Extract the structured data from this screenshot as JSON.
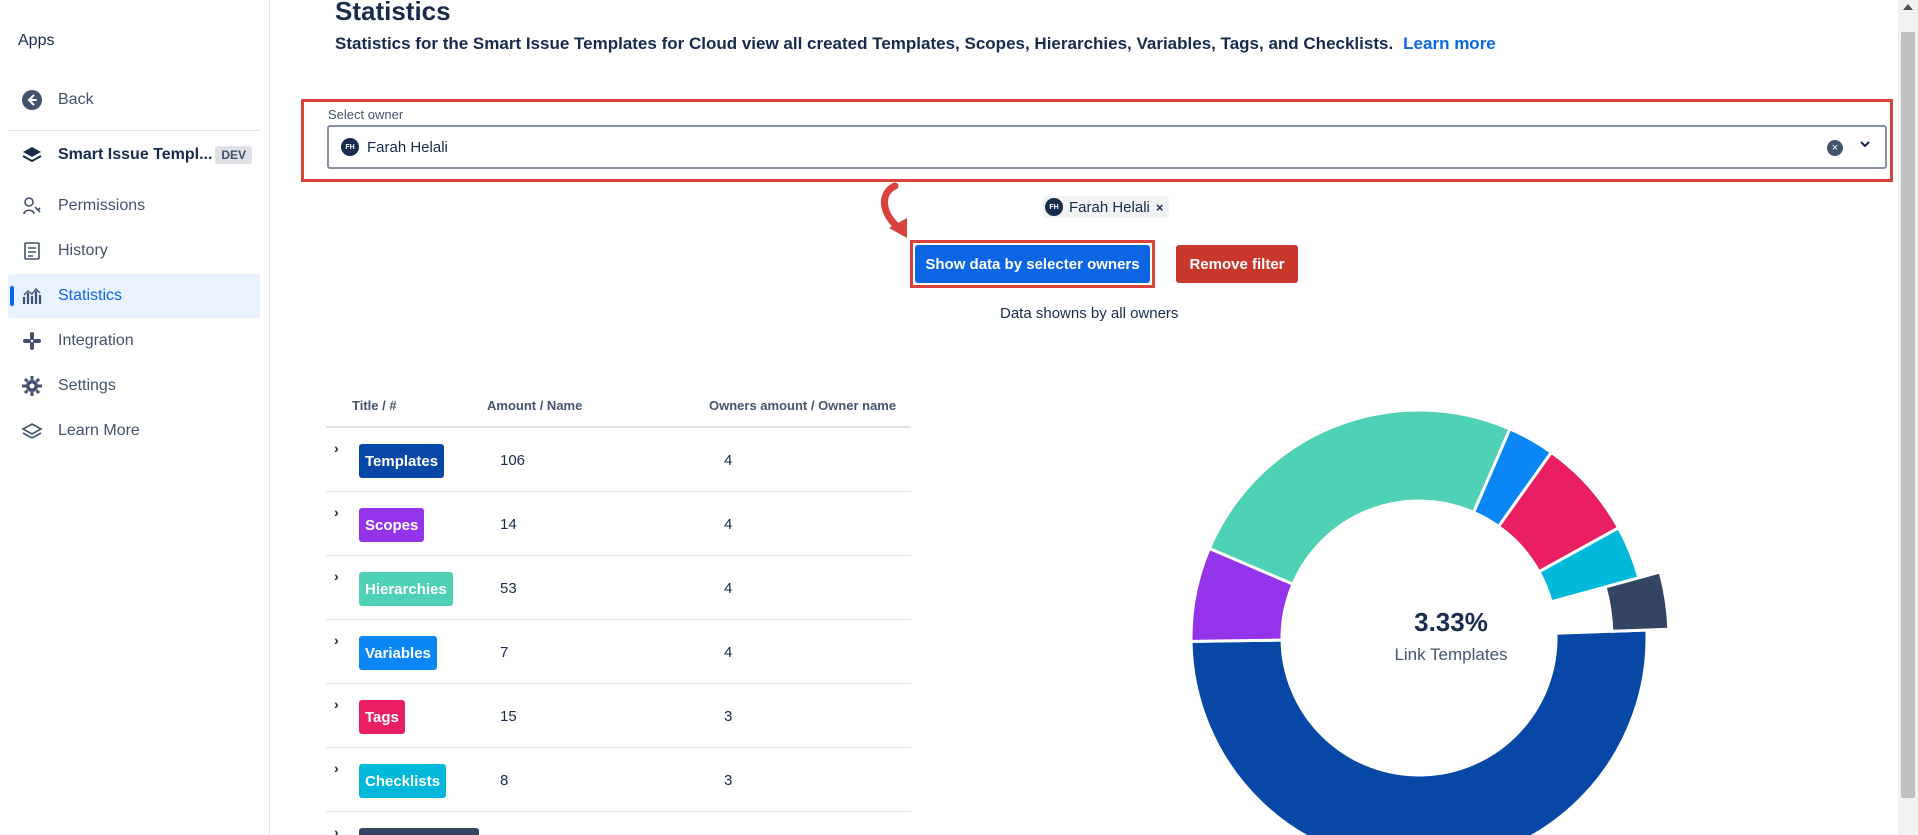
{
  "sidebar": {
    "apps_label": "Apps",
    "back_label": "Back",
    "app_name": "Smart Issue Templ...",
    "dev_badge": "DEV",
    "items": [
      {
        "label": "Permissions",
        "icon": "permissions-icon"
      },
      {
        "label": "History",
        "icon": "history-icon"
      },
      {
        "label": "Statistics",
        "icon": "statistics-icon",
        "active": true
      },
      {
        "label": "Integration",
        "icon": "integration-icon"
      },
      {
        "label": "Settings",
        "icon": "gear-icon"
      },
      {
        "label": "Learn More",
        "icon": "layers-icon"
      }
    ]
  },
  "page": {
    "title": "Statistics",
    "description": "Statistics for the Smart Issue Templates for Cloud view all created Templates, Scopes, Hierarchies, Variables, Tags, and Checklists.",
    "learn_more": "Learn more"
  },
  "owner_filter": {
    "label": "Select owner",
    "selected_value": "Farah Helali",
    "avatar_initials": "FH",
    "chip_label": "Farah Helali",
    "chip_remove": "×"
  },
  "actions": {
    "show_data_label": "Show data by selecter owners",
    "remove_filter_label": "Remove filter",
    "data_note": "Data showns by all owners"
  },
  "table": {
    "headers": [
      "Title / #",
      "Amount / Name",
      "Owners amount / Owner name"
    ],
    "expand_glyph": "›",
    "rows": [
      {
        "title": "Templates",
        "amount": "106",
        "owners": "4",
        "color": "#0747a6"
      },
      {
        "title": "Scopes",
        "amount": "14",
        "owners": "4",
        "color": "#9333ea"
      },
      {
        "title": "Hierarchies",
        "amount": "53",
        "owners": "4",
        "color": "#4fd1b5"
      },
      {
        "title": "Variables",
        "amount": "7",
        "owners": "4",
        "color": "#0b87f5"
      },
      {
        "title": "Tags",
        "amount": "15",
        "owners": "3",
        "color": "#e91e63"
      },
      {
        "title": "Checklists",
        "amount": "8",
        "owners": "3",
        "color": "#00b8d9"
      }
    ]
  },
  "chart_data": {
    "type": "pie",
    "center_value": "3.33%",
    "center_label": "Link Templates",
    "highlighted": "Link Templates",
    "slices": [
      {
        "label": "Templates",
        "value": 45.3,
        "color": "#0747a6"
      },
      {
        "label": "Scopes",
        "value": 6.0,
        "color": "#9333ea"
      },
      {
        "label": "Hierarchies",
        "value": 22.6,
        "color": "#4fd1b5"
      },
      {
        "label": "Variables",
        "value": 3.0,
        "color": "#0b87f5"
      },
      {
        "label": "Tags",
        "value": 6.4,
        "color": "#e91e63"
      },
      {
        "label": "Checklists",
        "value": 3.4,
        "color": "#00b8d9"
      },
      {
        "label": "Link Templates",
        "value": 3.33,
        "color": "#344563"
      }
    ]
  },
  "colors": {
    "primary": "#0c66e4",
    "danger": "#c9372c",
    "highlight_border": "#d9413c"
  }
}
